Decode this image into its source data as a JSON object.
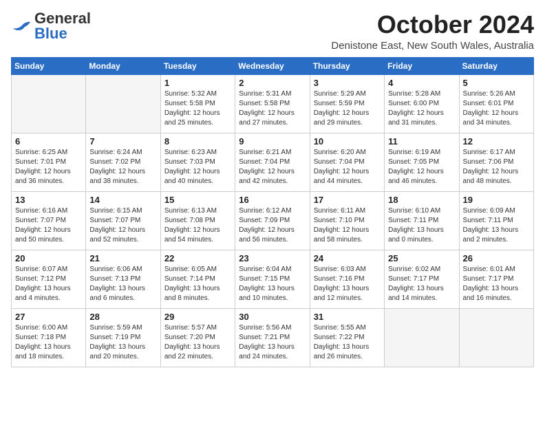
{
  "header": {
    "logo_general": "General",
    "logo_blue": "Blue",
    "month_title": "October 2024",
    "location": "Denistone East, New South Wales, Australia"
  },
  "days_of_week": [
    "Sunday",
    "Monday",
    "Tuesday",
    "Wednesday",
    "Thursday",
    "Friday",
    "Saturday"
  ],
  "weeks": [
    [
      {
        "day": "",
        "data": ""
      },
      {
        "day": "",
        "data": ""
      },
      {
        "day": "1",
        "sunrise": "Sunrise: 5:32 AM",
        "sunset": "Sunset: 5:58 PM",
        "daylight": "Daylight: 12 hours and 25 minutes."
      },
      {
        "day": "2",
        "sunrise": "Sunrise: 5:31 AM",
        "sunset": "Sunset: 5:58 PM",
        "daylight": "Daylight: 12 hours and 27 minutes."
      },
      {
        "day": "3",
        "sunrise": "Sunrise: 5:29 AM",
        "sunset": "Sunset: 5:59 PM",
        "daylight": "Daylight: 12 hours and 29 minutes."
      },
      {
        "day": "4",
        "sunrise": "Sunrise: 5:28 AM",
        "sunset": "Sunset: 6:00 PM",
        "daylight": "Daylight: 12 hours and 31 minutes."
      },
      {
        "day": "5",
        "sunrise": "Sunrise: 5:26 AM",
        "sunset": "Sunset: 6:01 PM",
        "daylight": "Daylight: 12 hours and 34 minutes."
      }
    ],
    [
      {
        "day": "6",
        "sunrise": "Sunrise: 6:25 AM",
        "sunset": "Sunset: 7:01 PM",
        "daylight": "Daylight: 12 hours and 36 minutes."
      },
      {
        "day": "7",
        "sunrise": "Sunrise: 6:24 AM",
        "sunset": "Sunset: 7:02 PM",
        "daylight": "Daylight: 12 hours and 38 minutes."
      },
      {
        "day": "8",
        "sunrise": "Sunrise: 6:23 AM",
        "sunset": "Sunset: 7:03 PM",
        "daylight": "Daylight: 12 hours and 40 minutes."
      },
      {
        "day": "9",
        "sunrise": "Sunrise: 6:21 AM",
        "sunset": "Sunset: 7:04 PM",
        "daylight": "Daylight: 12 hours and 42 minutes."
      },
      {
        "day": "10",
        "sunrise": "Sunrise: 6:20 AM",
        "sunset": "Sunset: 7:04 PM",
        "daylight": "Daylight: 12 hours and 44 minutes."
      },
      {
        "day": "11",
        "sunrise": "Sunrise: 6:19 AM",
        "sunset": "Sunset: 7:05 PM",
        "daylight": "Daylight: 12 hours and 46 minutes."
      },
      {
        "day": "12",
        "sunrise": "Sunrise: 6:17 AM",
        "sunset": "Sunset: 7:06 PM",
        "daylight": "Daylight: 12 hours and 48 minutes."
      }
    ],
    [
      {
        "day": "13",
        "sunrise": "Sunrise: 6:16 AM",
        "sunset": "Sunset: 7:07 PM",
        "daylight": "Daylight: 12 hours and 50 minutes."
      },
      {
        "day": "14",
        "sunrise": "Sunrise: 6:15 AM",
        "sunset": "Sunset: 7:07 PM",
        "daylight": "Daylight: 12 hours and 52 minutes."
      },
      {
        "day": "15",
        "sunrise": "Sunrise: 6:13 AM",
        "sunset": "Sunset: 7:08 PM",
        "daylight": "Daylight: 12 hours and 54 minutes."
      },
      {
        "day": "16",
        "sunrise": "Sunrise: 6:12 AM",
        "sunset": "Sunset: 7:09 PM",
        "daylight": "Daylight: 12 hours and 56 minutes."
      },
      {
        "day": "17",
        "sunrise": "Sunrise: 6:11 AM",
        "sunset": "Sunset: 7:10 PM",
        "daylight": "Daylight: 12 hours and 58 minutes."
      },
      {
        "day": "18",
        "sunrise": "Sunrise: 6:10 AM",
        "sunset": "Sunset: 7:11 PM",
        "daylight": "Daylight: 13 hours and 0 minutes."
      },
      {
        "day": "19",
        "sunrise": "Sunrise: 6:09 AM",
        "sunset": "Sunset: 7:11 PM",
        "daylight": "Daylight: 13 hours and 2 minutes."
      }
    ],
    [
      {
        "day": "20",
        "sunrise": "Sunrise: 6:07 AM",
        "sunset": "Sunset: 7:12 PM",
        "daylight": "Daylight: 13 hours and 4 minutes."
      },
      {
        "day": "21",
        "sunrise": "Sunrise: 6:06 AM",
        "sunset": "Sunset: 7:13 PM",
        "daylight": "Daylight: 13 hours and 6 minutes."
      },
      {
        "day": "22",
        "sunrise": "Sunrise: 6:05 AM",
        "sunset": "Sunset: 7:14 PM",
        "daylight": "Daylight: 13 hours and 8 minutes."
      },
      {
        "day": "23",
        "sunrise": "Sunrise: 6:04 AM",
        "sunset": "Sunset: 7:15 PM",
        "daylight": "Daylight: 13 hours and 10 minutes."
      },
      {
        "day": "24",
        "sunrise": "Sunrise: 6:03 AM",
        "sunset": "Sunset: 7:16 PM",
        "daylight": "Daylight: 13 hours and 12 minutes."
      },
      {
        "day": "25",
        "sunrise": "Sunrise: 6:02 AM",
        "sunset": "Sunset: 7:17 PM",
        "daylight": "Daylight: 13 hours and 14 minutes."
      },
      {
        "day": "26",
        "sunrise": "Sunrise: 6:01 AM",
        "sunset": "Sunset: 7:17 PM",
        "daylight": "Daylight: 13 hours and 16 minutes."
      }
    ],
    [
      {
        "day": "27",
        "sunrise": "Sunrise: 6:00 AM",
        "sunset": "Sunset: 7:18 PM",
        "daylight": "Daylight: 13 hours and 18 minutes."
      },
      {
        "day": "28",
        "sunrise": "Sunrise: 5:59 AM",
        "sunset": "Sunset: 7:19 PM",
        "daylight": "Daylight: 13 hours and 20 minutes."
      },
      {
        "day": "29",
        "sunrise": "Sunrise: 5:57 AM",
        "sunset": "Sunset: 7:20 PM",
        "daylight": "Daylight: 13 hours and 22 minutes."
      },
      {
        "day": "30",
        "sunrise": "Sunrise: 5:56 AM",
        "sunset": "Sunset: 7:21 PM",
        "daylight": "Daylight: 13 hours and 24 minutes."
      },
      {
        "day": "31",
        "sunrise": "Sunrise: 5:55 AM",
        "sunset": "Sunset: 7:22 PM",
        "daylight": "Daylight: 13 hours and 26 minutes."
      },
      {
        "day": "",
        "data": ""
      },
      {
        "day": "",
        "data": ""
      }
    ]
  ]
}
